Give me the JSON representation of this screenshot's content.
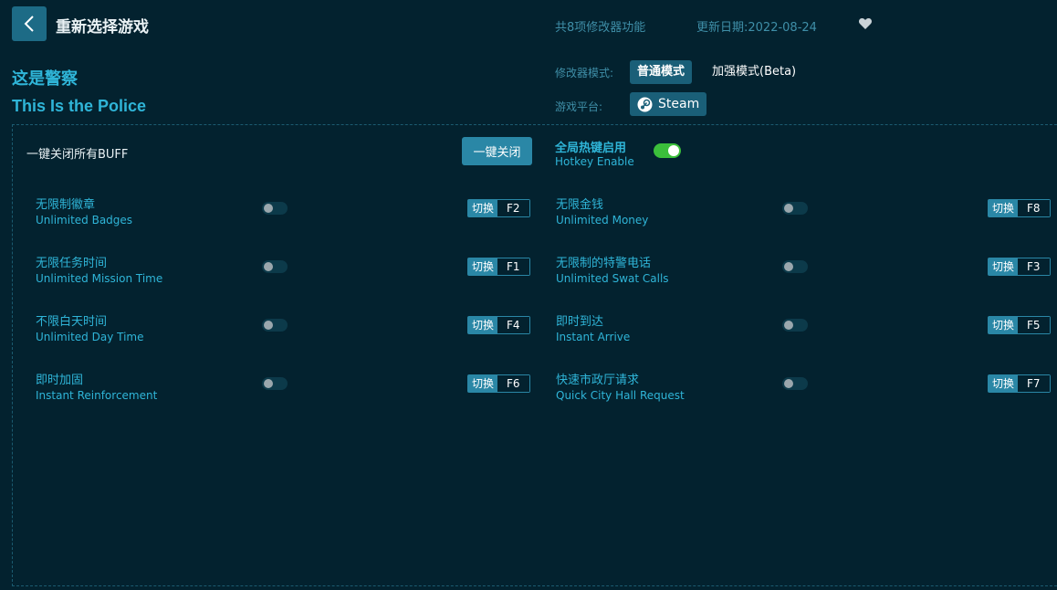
{
  "header": {
    "title": "重新选择游戏",
    "feature_count": "共8项修改器功能",
    "update_date": "更新日期:2022-08-24"
  },
  "game": {
    "name_cn": "这是警察",
    "name_en": "This Is the Police"
  },
  "mode": {
    "label": "修改器模式:",
    "normal": "普通模式",
    "enhanced": "加强模式(Beta)"
  },
  "platform": {
    "label": "游戏平台:",
    "name": "Steam"
  },
  "controls": {
    "buff_label": "一键关闭所有BUFF",
    "close_all": "一键关闭",
    "hotkey_cn": "全局热键启用",
    "hotkey_en": "Hotkey Enable",
    "hotkey_enabled": true
  },
  "switch_label": "切换",
  "options": [
    {
      "cn": "无限制徽章",
      "en": "Unlimited Badges",
      "key": "F2",
      "on": false
    },
    {
      "cn": "无限金钱",
      "en": "Unlimited Money",
      "key": "F8",
      "on": false
    },
    {
      "cn": "无限任务时间",
      "en": "Unlimited Mission Time",
      "key": "F1",
      "on": false
    },
    {
      "cn": "无限制的特警电话",
      "en": "Unlimited Swat Calls",
      "key": "F3",
      "on": false
    },
    {
      "cn": "不限白天时间",
      "en": "Unlimited Day Time",
      "key": "F4",
      "on": false
    },
    {
      "cn": "即时到达",
      "en": "Instant Arrive",
      "key": "F5",
      "on": false
    },
    {
      "cn": "即时加固",
      "en": "Instant Reinforcement",
      "key": "F6",
      "on": false
    },
    {
      "cn": "快速市政厅请求",
      "en": "Quick City Hall Request",
      "key": "F7",
      "on": false
    }
  ],
  "icons": {
    "back": "chevron-left-icon",
    "favorite": "heart-icon",
    "platform": "steam-icon"
  },
  "colors": {
    "background": "#03222f",
    "accent": "#2fb5d8",
    "toggle_on": "#3bbf3b"
  }
}
